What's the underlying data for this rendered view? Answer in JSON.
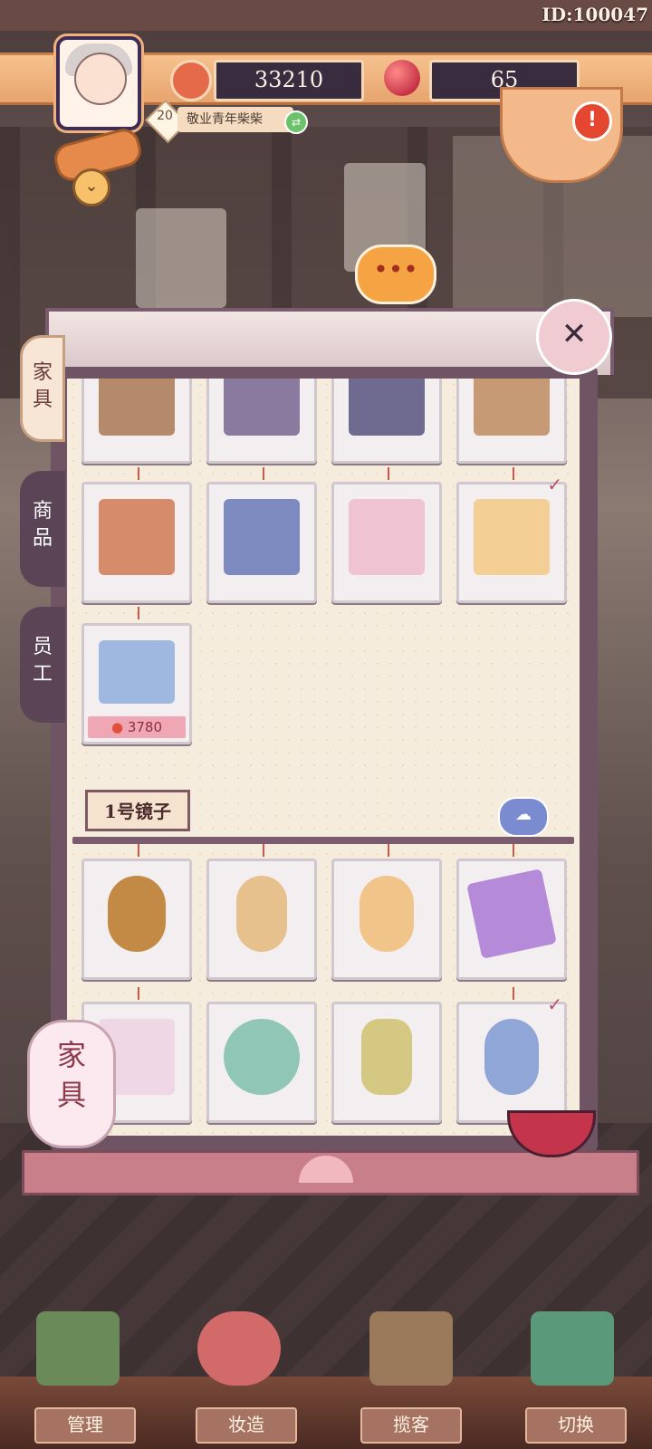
{
  "header": {
    "player_id": "ID:100047",
    "coins": "33210",
    "gems": "65",
    "level": "20",
    "player_title": "敬业青年柴柴",
    "colors": {
      "resource_bar": "#e7a46e",
      "resource_box": "#3a2c3f"
    },
    "icons": [
      "coin-icon",
      "gem-icon",
      "avatar-icon",
      "alert-icon"
    ]
  },
  "tabs": [
    {
      "label_top": "家",
      "label_bottom": "具",
      "active": true
    },
    {
      "label_top": "商",
      "label_bottom": "品",
      "active": false
    },
    {
      "label_top": "员",
      "label_bottom": "工",
      "active": false
    }
  ],
  "close_icon": "✕",
  "upper_grid": {
    "rows": [
      [
        {
          "art": "#b58a6a"
        },
        {
          "art": "#8a7aa0"
        },
        {
          "art": "#6f6a90"
        },
        {
          "art": "#c69a74"
        }
      ],
      [
        {
          "art": "#d68b6a"
        },
        {
          "art": "#7d8ac0"
        },
        {
          "art": "#f0c3d3"
        },
        {
          "art": "#f3cf95",
          "checked": true
        }
      ],
      [
        {
          "art": "#9fb8e0",
          "price": "3780"
        }
      ]
    ]
  },
  "section": {
    "label": "1号镜子",
    "cloud_icon": "cloud-icon"
  },
  "mirror_grid": {
    "rows": [
      [
        {
          "art": "#c28a44"
        },
        {
          "art": "#e7c18d"
        },
        {
          "art": "#f1c48a"
        },
        {
          "art": "#b58ad8"
        }
      ],
      [
        {
          "art": "#f0d7e5"
        },
        {
          "art": "#8fc6b5"
        },
        {
          "art": "#d4c883"
        },
        {
          "art": "#8fa6d6",
          "checked": true
        }
      ]
    ]
  },
  "lantern": {
    "line1": "家",
    "line2": "具"
  },
  "bottom_nav": [
    {
      "label": "管理",
      "icon": "shop-icon",
      "color": "#6a8a5a"
    },
    {
      "label": "妆造",
      "icon": "makeup-icon",
      "color": "#d36a6a"
    },
    {
      "label": "揽客",
      "icon": "signpost-icon",
      "color": "#9a7a5a"
    },
    {
      "label": "切换",
      "icon": "map-icon",
      "color": "#5a9a7a"
    }
  ]
}
